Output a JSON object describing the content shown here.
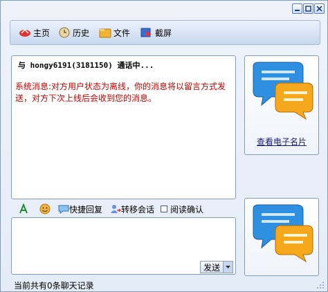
{
  "toolbar": {
    "items": [
      {
        "label": "主页",
        "icon": "home-icon"
      },
      {
        "label": "历史",
        "icon": "history-icon"
      },
      {
        "label": "文件",
        "icon": "folder-icon"
      },
      {
        "label": "截屏",
        "icon": "screenshot-icon"
      }
    ]
  },
  "window_controls": {
    "minimize": "minimize-icon",
    "maximize": "maximize-icon",
    "close": "close-icon"
  },
  "chat": {
    "header": "与 hongy6191(3181150) 通话中...",
    "system_message": "系统消息:对方用户状态为离线，你的消息将以留言方式发送，对方下次上线后会收到您的消息。"
  },
  "side": {
    "card_link": "查看电子名片",
    "card_icon": "chat-bubbles-icon"
  },
  "midbar": {
    "quick_reply": "快捷回复",
    "transfer": "转移会话",
    "read_receipt": "阅读确认",
    "read_receipt_checked": false
  },
  "input": {
    "value": ""
  },
  "send": {
    "label": "发送"
  },
  "status": {
    "text": "当前共有0条聊天记录"
  },
  "colors": {
    "system_message": "#cc0000",
    "accent": "#7f9db9"
  }
}
